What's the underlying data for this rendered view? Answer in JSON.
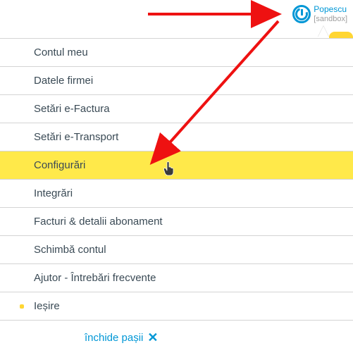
{
  "user": {
    "name": "Popescu",
    "env": "[sandbox]"
  },
  "menu": {
    "items": [
      {
        "label": "Contul meu",
        "highlight": false
      },
      {
        "label": "Datele firmei",
        "highlight": false
      },
      {
        "label": "Setări e-Factura",
        "highlight": false
      },
      {
        "label": "Setări e-Transport",
        "highlight": false
      },
      {
        "label": "Configurări",
        "highlight": true
      },
      {
        "label": "Integrări",
        "highlight": false
      },
      {
        "label": "Facturi & detalii abonament",
        "highlight": false
      },
      {
        "label": "Schimbă contul",
        "highlight": false
      },
      {
        "label": "Ajutor - Întrebări frecvente",
        "highlight": false
      },
      {
        "label": "Ieșire",
        "highlight": false,
        "dot": true
      }
    ]
  },
  "footer": {
    "close_steps": "închide pașii"
  }
}
